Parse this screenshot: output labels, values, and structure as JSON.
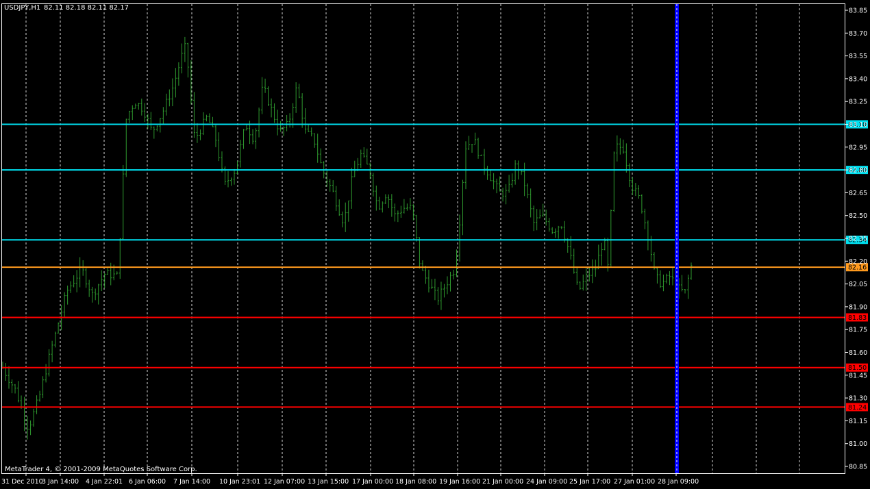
{
  "header": {
    "symbol": "USDJPY,H1",
    "ohlc": "82.11 82.18 82.11 82.17"
  },
  "footer": {
    "copyright": "MetaTrader 4, © 2001-2009 MetaQuotes Software Corp."
  },
  "colors": {
    "background": "#000000",
    "border": "#ffffff",
    "grid": "#ffffff",
    "bar": "#2f9a2f",
    "support": "#ff0000",
    "resistance": "#00e0f0",
    "current": "#ff9a1e",
    "marker": "#0000ff",
    "axis_text": "#ffffff"
  },
  "chart_data": {
    "type": "ohlc",
    "symbol": "USDJPY",
    "timeframe": "H1",
    "ylim": [
      80.85,
      83.85
    ],
    "y_ticks": [
      "83.85",
      "83.70",
      "83.55",
      "83.40",
      "83.25",
      "83.10",
      "82.95",
      "82.80",
      "82.65",
      "82.50",
      "82.35",
      "82.20",
      "82.05",
      "81.90",
      "81.75",
      "81.60",
      "81.45",
      "81.30",
      "81.15",
      "81.00",
      "80.85"
    ],
    "x_ticks": [
      "31 Dec 2010",
      "3 Jan 14:00",
      "4 Jan 22:01",
      "6 Jan 06:00",
      "7 Jan 14:00",
      "10 Jan 23:01",
      "12 Jan 07:00",
      "13 Jan 15:00",
      "17 Jan 00:00",
      "18 Jan 08:00",
      "19 Jan 16:00",
      "21 Jan 00:00",
      "24 Jan 09:00",
      "25 Jan 17:00",
      "27 Jan 01:00",
      "28 Jan 09:00"
    ],
    "bar_count": 224,
    "close_path": [
      [
        0,
        81.5
      ],
      [
        6,
        81.35
      ],
      [
        12,
        81.1
      ],
      [
        17,
        81.3
      ],
      [
        22,
        81.58
      ],
      [
        30,
        82.0
      ],
      [
        37,
        82.15
      ],
      [
        42,
        81.98
      ],
      [
        48,
        82.12
      ],
      [
        54,
        82.1
      ],
      [
        58,
        83.15
      ],
      [
        62,
        83.25
      ],
      [
        66,
        83.2
      ],
      [
        70,
        83.05
      ],
      [
        75,
        83.18
      ],
      [
        80,
        83.35
      ],
      [
        84,
        83.55
      ],
      [
        86,
        83.62
      ],
      [
        90,
        83.0
      ],
      [
        96,
        83.15
      ],
      [
        100,
        83.0
      ],
      [
        104,
        82.7
      ],
      [
        109,
        82.8
      ],
      [
        114,
        83.1
      ],
      [
        118,
        83.0
      ],
      [
        122,
        83.35
      ],
      [
        126,
        83.2
      ],
      [
        130,
        83.05
      ],
      [
        134,
        83.1
      ],
      [
        138,
        83.35
      ],
      [
        142,
        83.05
      ],
      [
        146,
        83.0
      ],
      [
        150,
        82.8
      ],
      [
        155,
        82.65
      ],
      [
        160,
        82.45
      ],
      [
        164,
        82.75
      ],
      [
        168,
        82.9
      ],
      [
        172,
        82.8
      ],
      [
        176,
        82.55
      ],
      [
        180,
        82.65
      ],
      [
        184,
        82.5
      ],
      [
        188,
        82.55
      ],
      [
        192,
        82.55
      ],
      [
        196,
        82.15
      ],
      [
        200,
        82.05
      ],
      [
        204,
        81.95
      ],
      [
        208,
        82.05
      ],
      [
        212,
        82.15
      ],
      [
        214,
        82.4
      ],
      [
        217,
        82.95
      ],
      [
        221,
        83.0
      ],
      [
        225,
        82.85
      ],
      [
        229,
        82.75
      ],
      [
        233,
        82.65
      ],
      [
        237,
        82.65
      ],
      [
        241,
        82.85
      ],
      [
        245,
        82.7
      ],
      [
        249,
        82.45
      ],
      [
        253,
        82.5
      ],
      [
        258,
        82.4
      ],
      [
        262,
        82.45
      ],
      [
        266,
        82.25
      ],
      [
        270,
        82.0
      ],
      [
        274,
        82.1
      ],
      [
        278,
        82.15
      ],
      [
        282,
        82.35
      ],
      [
        284,
        82.15
      ],
      [
        287,
        82.95
      ],
      [
        291,
        82.95
      ],
      [
        295,
        82.7
      ],
      [
        299,
        82.6
      ],
      [
        303,
        82.35
      ],
      [
        306,
        82.1
      ],
      [
        309,
        82.05
      ],
      [
        313,
        82.1
      ],
      [
        317,
        82.02
      ],
      [
        320,
        81.99
      ],
      [
        323,
        82.17
      ]
    ],
    "levels": [
      {
        "price": 83.1,
        "label": "83.10",
        "kind": "resistance"
      },
      {
        "price": 82.8,
        "label": "82.80",
        "kind": "resistance"
      },
      {
        "price": 82.34,
        "label": "82.34",
        "kind": "resistance"
      },
      {
        "price": 82.16,
        "label": "82.16",
        "kind": "current"
      },
      {
        "price": 81.83,
        "label": "81.83",
        "kind": "support"
      },
      {
        "price": 81.5,
        "label": "81.50",
        "kind": "support"
      },
      {
        "price": 81.24,
        "label": "81.24",
        "kind": "support"
      }
    ],
    "marker": {
      "label": "28 Jan 09:00"
    },
    "grid": true
  }
}
